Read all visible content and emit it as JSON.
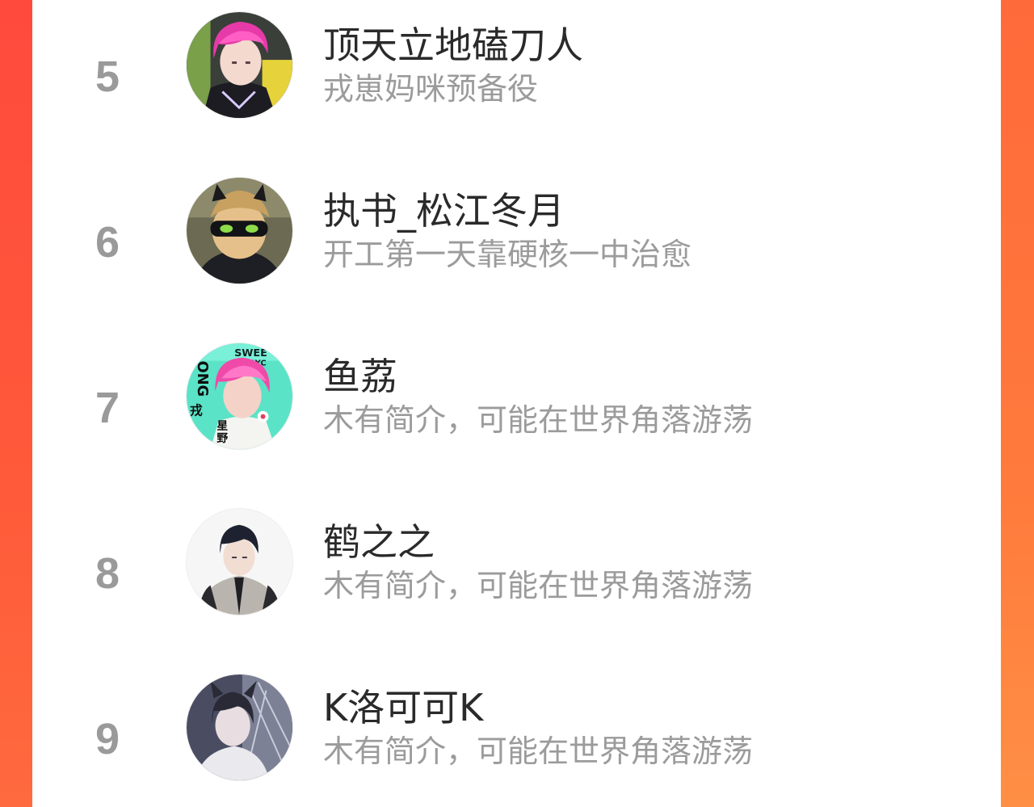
{
  "ranking": {
    "entries": [
      {
        "rank": "5",
        "name": "顶天立地磕刀人",
        "bio": "戎崽妈咪预备役",
        "avatar_icon": "pink-hair-character-avatar"
      },
      {
        "rank": "6",
        "name": "执书_松江冬月",
        "bio": "开工第一天靠硬核一中治愈",
        "avatar_icon": "masked-cat-hero-avatar"
      },
      {
        "rank": "7",
        "name": "鱼荔",
        "bio": "木有简介，可能在世界角落游荡",
        "avatar_icon": "pink-hair-poster-avatar",
        "avatar_text": [
          "SWEE",
          "SSYC",
          "ONG",
          "戎",
          "星",
          "野"
        ]
      },
      {
        "rank": "8",
        "name": "鹤之之",
        "bio": "木有简介，可能在世界角落游荡",
        "avatar_icon": "suited-boy-avatar"
      },
      {
        "rank": "9",
        "name": "K洛可可K",
        "bio": "木有简介，可能在世界角落游荡",
        "avatar_icon": "dark-fantasy-character-avatar"
      }
    ]
  },
  "colors": {
    "background_left": "#ff4a3d",
    "background_right": "#ff7a3c",
    "card": "#ffffff",
    "rank_text": "#9a9a9a",
    "name_text": "#2a2a2a",
    "bio_text": "#9b9b9b"
  }
}
